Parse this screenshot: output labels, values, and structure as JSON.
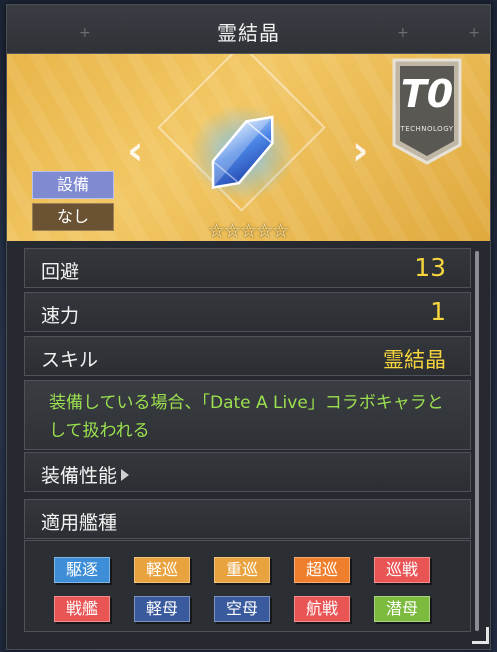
{
  "window": {
    "title": "霊結晶"
  },
  "banner": {
    "rank": "T0",
    "rank_sub": "TECHNOLOGY",
    "tag_type": "設備",
    "tag_equipped": "なし",
    "stars": "☆☆☆☆☆",
    "rarity_stars": 5,
    "bg_color": "#ecb94d"
  },
  "stats": [
    {
      "label": "回避",
      "value": "13"
    },
    {
      "label": "速力",
      "value": "1"
    },
    {
      "label": "スキル",
      "value": "霊結晶"
    }
  ],
  "description": "装備している場合、「Date A Live」コラボキャラとして扱われる",
  "sections": {
    "performance": "装備性能",
    "ship_types": "適用艦種"
  },
  "ship_types": [
    {
      "label": "駆逐",
      "color": "#3d8ed6"
    },
    {
      "label": "軽巡",
      "color": "#e9a33e"
    },
    {
      "label": "重巡",
      "color": "#e9a33e"
    },
    {
      "label": "超巡",
      "color": "#ef7f2c"
    },
    {
      "label": "巡戦",
      "color": "#e95454"
    },
    {
      "label": "戦艦",
      "color": "#e95454"
    },
    {
      "label": "軽母",
      "color": "#3a5a9e"
    },
    {
      "label": "空母",
      "color": "#3a5a9e"
    },
    {
      "label": "航戦",
      "color": "#e95454"
    },
    {
      "label": "潜母",
      "color": "#7dbb3f"
    }
  ]
}
